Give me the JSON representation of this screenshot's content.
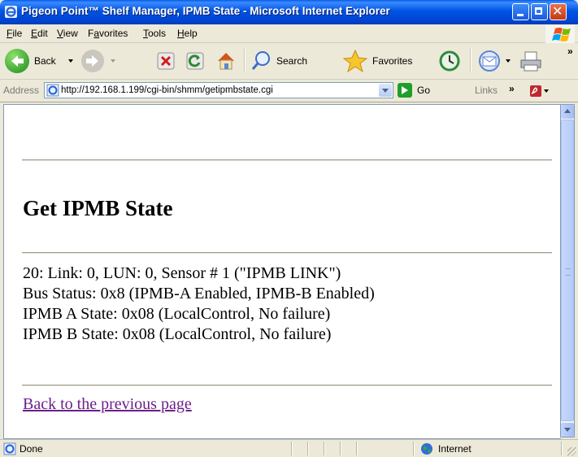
{
  "window": {
    "title": "Pigeon Point™ Shelf Manager, IPMB State - Microsoft Internet Explorer"
  },
  "menu": [
    {
      "label": "File",
      "underline": "F",
      "rest": "ile"
    },
    {
      "label": "Edit",
      "underline": "E",
      "rest": "dit"
    },
    {
      "label": "View",
      "underline": "V",
      "rest": "iew"
    },
    {
      "label": "Favorites",
      "underline": "a",
      "prefix": "F",
      "rest": "vorites"
    },
    {
      "label": "Tools",
      "underline": "T",
      "rest": "ools"
    },
    {
      "label": "Help",
      "underline": "H",
      "rest": "elp"
    }
  ],
  "toolbar": {
    "back_label": "Back",
    "search_label": "Search",
    "favorites_label": "Favorites"
  },
  "address": {
    "label": "Address",
    "url": "http://192.168.1.199/cgi-bin/shmm/getipmbstate.cgi",
    "go_label": "Go",
    "links_label": "Links",
    "chevron": "»"
  },
  "page": {
    "heading": "Get IPMB State",
    "lines": [
      "20: Link: 0, LUN: 0, Sensor # 1 (\"IPMB LINK\")",
      "Bus Status: 0x8 (IPMB-A Enabled, IPMB-B Enabled)",
      "IPMB A State: 0x08 (LocalControl, No failure)",
      "IPMB B State: 0x08 (LocalControl, No failure)"
    ],
    "back_link": "Back to the previous page"
  },
  "status": {
    "text": "Done",
    "zone": "Internet"
  }
}
